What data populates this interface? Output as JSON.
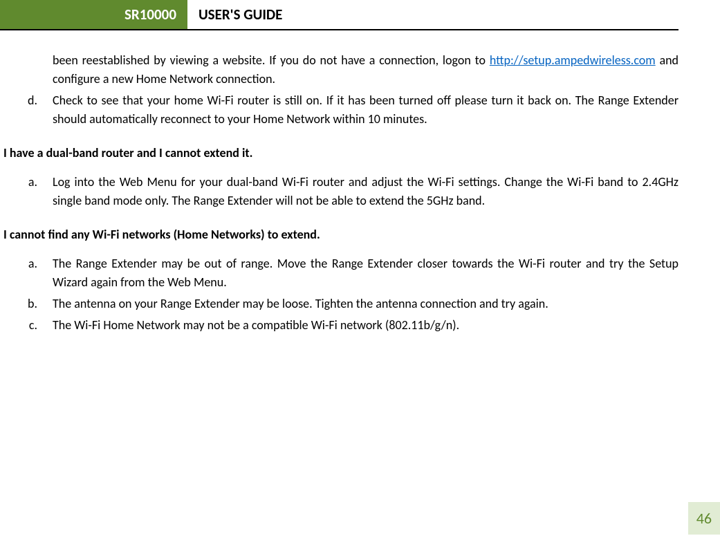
{
  "header": {
    "model": "SR10000",
    "title": "USER'S GUIDE"
  },
  "content": {
    "first_fragment_pre": "been reestablished by viewing a website. If you do not have a connection, logon to ",
    "first_fragment_link": "http://setup.ampedwireless.com",
    "first_fragment_post": " and configure a new Home Network connection.",
    "item_d_marker": "d.",
    "item_d": "Check to see that your home Wi-Fi router is still on. If it has been turned off please turn it back on.  The Range Extender should automatically reconnect to your Home Network within 10 minutes.",
    "heading1": "I have a dual-band router and I cannot extend it.",
    "sec1_a_marker": "a.",
    "sec1_a": "Log into the Web Menu for your dual-band Wi-Fi router and adjust the Wi-Fi settings. Change the Wi-Fi band to 2.4GHz single band mode only. The Range Extender will not be able to extend the 5GHz band.",
    "heading2": "I cannot find any Wi-Fi networks (Home Networks) to extend.",
    "sec2_a_marker": "a.",
    "sec2_a": "The Range Extender may be out of range. Move the Range Extender closer towards the Wi-Fi router and try the Setup Wizard again from the Web Menu.",
    "sec2_b_marker": "b.",
    "sec2_b": "The antenna on your Range Extender may be loose. Tighten the antenna connection and try again.",
    "sec2_c_marker": "c.",
    "sec2_c": "The Wi-Fi Home Network may not be a compatible Wi-Fi network (802.11b/g/n)."
  },
  "page_number": "46"
}
